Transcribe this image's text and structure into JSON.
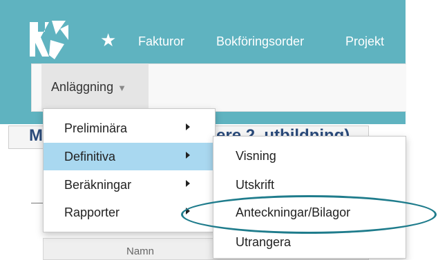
{
  "topbar": {
    "colors": {
      "bar": "#5fb3c0",
      "highlight_ring": "#1f7c8c",
      "active_item": "#a9d8f0"
    },
    "logo_icon": "app-logo",
    "star_icon": "star-icon",
    "nav": [
      {
        "label": "Fakturor"
      },
      {
        "label": "Bokföringsorder"
      },
      {
        "label": "Projekt"
      }
    ]
  },
  "subbar": {
    "module_label": "Anläggning"
  },
  "background": {
    "title_fragment_left": "M",
    "title_fragment_right": "ere 2, utbildning)",
    "table_header": "Namn"
  },
  "menu": {
    "items": [
      {
        "label": "Preliminära"
      },
      {
        "label": "Definitiva"
      },
      {
        "label": "Beräkningar"
      },
      {
        "label": "Rapporter"
      }
    ],
    "active_index": 1,
    "submenu": [
      {
        "label": "Visning"
      },
      {
        "label": "Utskrift"
      },
      {
        "label": "Anteckningar/Bilagor"
      },
      {
        "label": "Utrangera"
      }
    ]
  }
}
